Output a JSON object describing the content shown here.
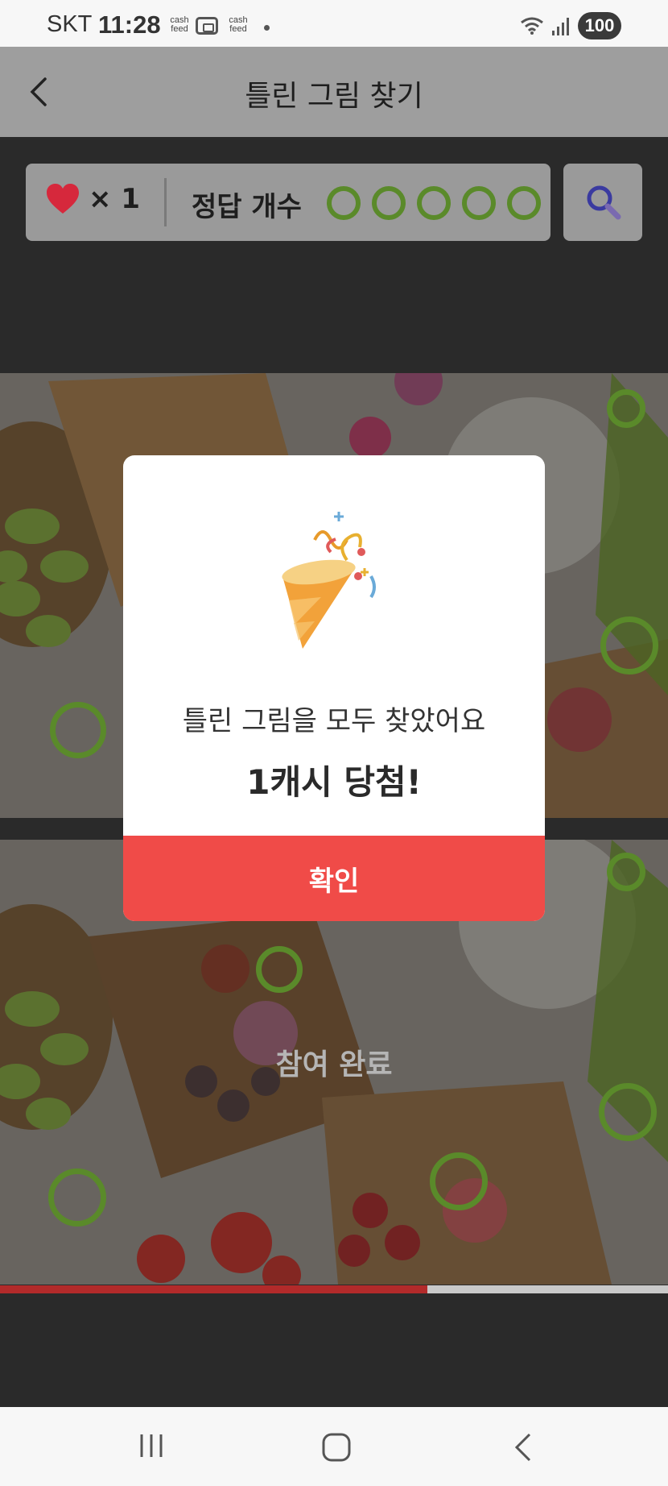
{
  "status_bar": {
    "carrier": "SKT",
    "time": "11:28",
    "cash_feed_1": "cash feed",
    "cash_feed_2": "cash feed",
    "battery": "100"
  },
  "header": {
    "title": "틀린 그림 찾기",
    "back_icon": "chevron-left-icon"
  },
  "score": {
    "lives_label": "× 1",
    "answer_label": "정답 개수",
    "found": 5,
    "total": 5
  },
  "game": {
    "status_text": "참여 완료",
    "progress_fraction": 0.64
  },
  "modal": {
    "message": "틀린 그림을 모두 찾았어요",
    "prize": "1캐시 당첨!",
    "confirm_label": "확인"
  },
  "colors": {
    "accent": "#f04b48",
    "marker": "#5a8a2a",
    "heart": "#d6283c"
  }
}
